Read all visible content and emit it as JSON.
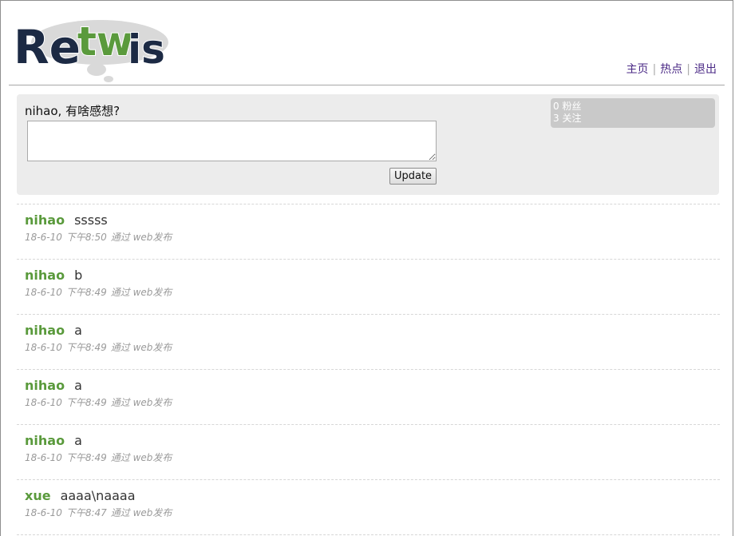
{
  "header": {
    "logo_text": "Retwis",
    "nav": [
      {
        "label": "主页"
      },
      {
        "label": "热点"
      },
      {
        "label": "退出"
      }
    ]
  },
  "post_box": {
    "prompt": "nihao, 有啥感想?",
    "input_value": "",
    "update_label": "Update",
    "stats": {
      "followers": "0 粉丝",
      "following": "3 关注"
    }
  },
  "timeline": [
    {
      "user": "nihao",
      "text": "sssss",
      "date": "18-6-10",
      "time": "下午8:50",
      "via": "通过 web发布"
    },
    {
      "user": "nihao",
      "text": "b",
      "date": "18-6-10",
      "time": "下午8:49",
      "via": "通过 web发布"
    },
    {
      "user": "nihao",
      "text": "a",
      "date": "18-6-10",
      "time": "下午8:49",
      "via": "通过 web发布"
    },
    {
      "user": "nihao",
      "text": "a",
      "date": "18-6-10",
      "time": "下午8:49",
      "via": "通过 web发布"
    },
    {
      "user": "nihao",
      "text": "a",
      "date": "18-6-10",
      "time": "下午8:49",
      "via": "通过 web发布"
    },
    {
      "user": "xue",
      "text": "aaaa\\naaaa",
      "date": "18-6-10",
      "time": "下午8:47",
      "via": "通过 web发布"
    }
  ],
  "colors": {
    "username_green": "#5a9a3c",
    "nav_link": "#4b2a86",
    "panel_bg": "#ececec",
    "stats_bg": "#c9c9c9"
  }
}
